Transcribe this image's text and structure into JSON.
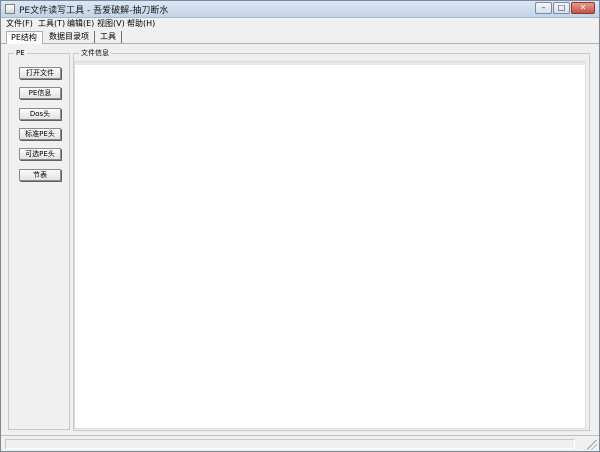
{
  "window": {
    "title": "PE文件读写工具 - 吾爱破解-抽刀断水",
    "controls": {
      "minimize": "–",
      "maximize": "□",
      "close": "✕"
    }
  },
  "menubar": {
    "items": [
      {
        "label": "文件(F)"
      },
      {
        "label": "工具(T)"
      },
      {
        "label": "编辑(E)"
      },
      {
        "label": "视图(V)"
      },
      {
        "label": "帮助(H)"
      }
    ]
  },
  "tabs": [
    {
      "label": "PE结构",
      "active": true
    },
    {
      "label": "数据目录项",
      "active": false
    },
    {
      "label": "工具",
      "active": false
    }
  ],
  "left_panel": {
    "legend": "PE",
    "buttons": [
      {
        "label": "打开文件"
      },
      {
        "label": "PE信息"
      },
      {
        "label": "Dos头"
      },
      {
        "label": "标准PE头"
      },
      {
        "label": "可选PE头"
      },
      {
        "label": "节表"
      }
    ]
  },
  "file_info": {
    "legend": "文件信息",
    "content": ""
  }
}
